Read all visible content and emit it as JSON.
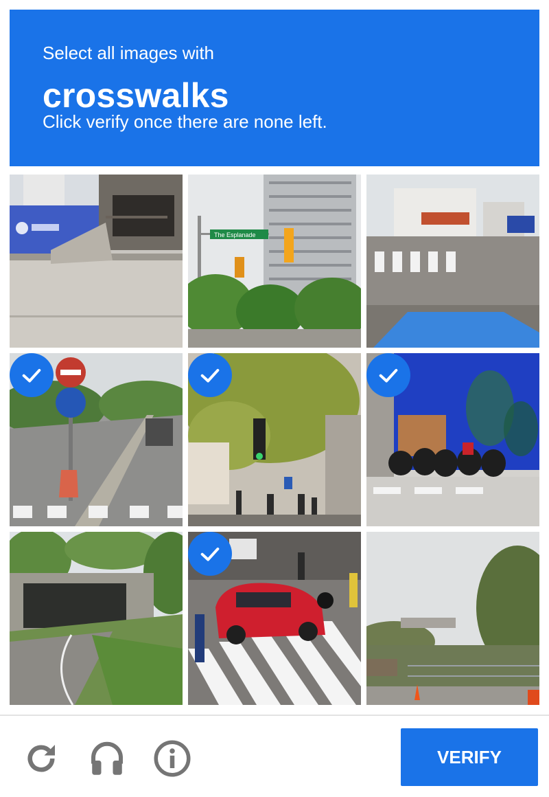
{
  "header": {
    "line1": "Select all images with",
    "keyword": "crosswalks",
    "line3": "Click verify once there are none left.",
    "background": "#1a73e8"
  },
  "tiles": [
    {
      "index": 1,
      "selected": false,
      "scene": "building entrance with ramp, blue construction banner"
    },
    {
      "index": 2,
      "selected": false,
      "scene": "street sign and traffic light near tall apartment tower",
      "sign_text": "The Esplanade"
    },
    {
      "index": 3,
      "selected": false,
      "scene": "street corner with crosswalk and blue canopy"
    },
    {
      "index": 4,
      "selected": true,
      "scene": "highway lane with no-entry and direction signs"
    },
    {
      "index": 5,
      "selected": true,
      "scene": "tree-lined street with traffic lights and pedestrians"
    },
    {
      "index": 6,
      "selected": true,
      "scene": "parked motorcycles beside blue mural wall"
    },
    {
      "index": 7,
      "selected": false,
      "scene": "road through overpass tunnel"
    },
    {
      "index": 8,
      "selected": true,
      "scene": "red car on zebra crosswalk with pedestrians"
    },
    {
      "index": 9,
      "selected": false,
      "scene": "roadside with traffic cones and railing"
    }
  ],
  "footer": {
    "reload_icon": "reload-icon",
    "audio_icon": "headphones-icon",
    "info_icon": "info-icon",
    "verify_label": "VERIFY"
  },
  "colors": {
    "accent": "#1a73e8",
    "icon_gray": "#757575"
  }
}
